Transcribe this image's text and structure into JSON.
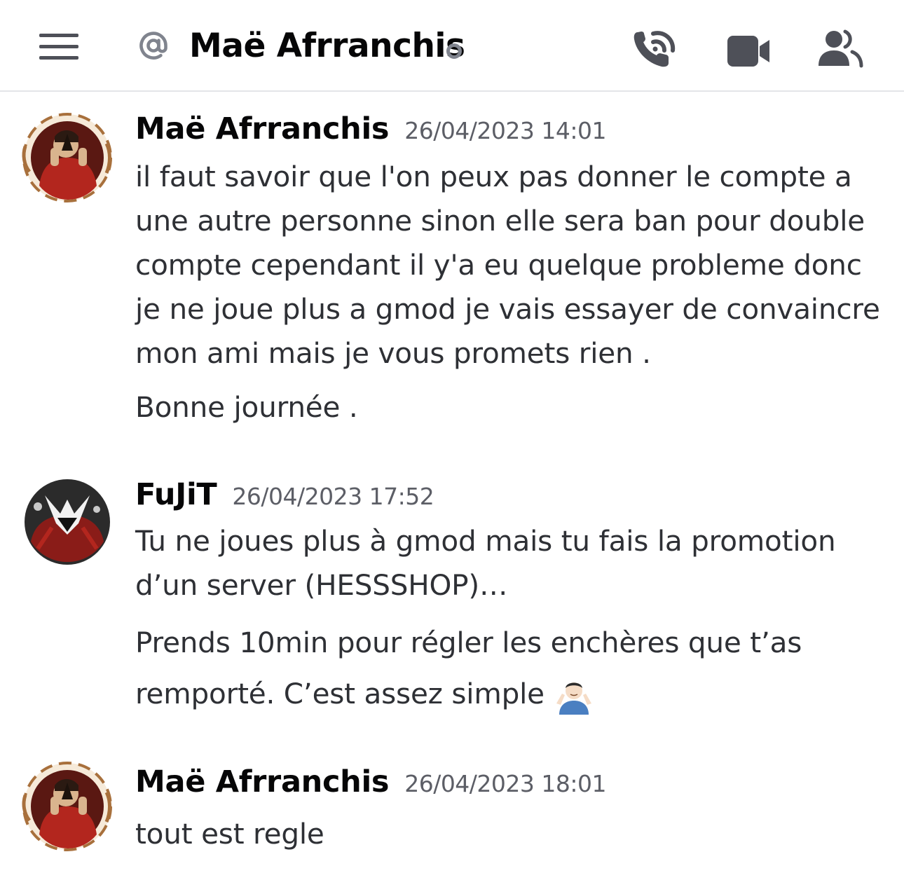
{
  "header": {
    "channel_name": "Maë  Afrranchis",
    "status": "offline",
    "icons": [
      "menu-icon",
      "at-icon",
      "call-icon",
      "video-icon",
      "members-icon"
    ]
  },
  "messages": [
    {
      "author": "Maë  Afrranchis",
      "timestamp": "26/04/2023 14:01",
      "avatar": "avatar-red-jumpsuit-mask",
      "lines": [
        "il faut savoir que l'on peux pas donner le compte a une autre personne sinon elle sera ban pour double compte cependant il y'a eu quelque probleme donc je ne joue plus a gmod je vais essayer de convaincre mon ami mais je vous promets rien .",
        "Bonne journée ."
      ]
    },
    {
      "author": "FuJiT",
      "timestamp": "26/04/2023 17:52",
      "avatar": "avatar-venom-red",
      "lines": [
        "Tu ne joues plus à gmod mais tu fais la promotion d’un server (HESSSHOP)…",
        "Prends 10min pour régler les enchères que t’as remporté. C’est assez simple"
      ],
      "emoji": "person-shrugging-emoji"
    },
    {
      "author": "Maë  Afrranchis",
      "timestamp": "26/04/2023 18:01",
      "avatar": "avatar-red-jumpsuit-mask",
      "lines": [
        "tout est regle"
      ]
    }
  ],
  "colors": {
    "background": "#ffffff",
    "text": "#2e3035",
    "username": "#060607",
    "timestamp": "#5c5e66",
    "icon": "#4e5058",
    "divider": "#e3e5e8"
  }
}
